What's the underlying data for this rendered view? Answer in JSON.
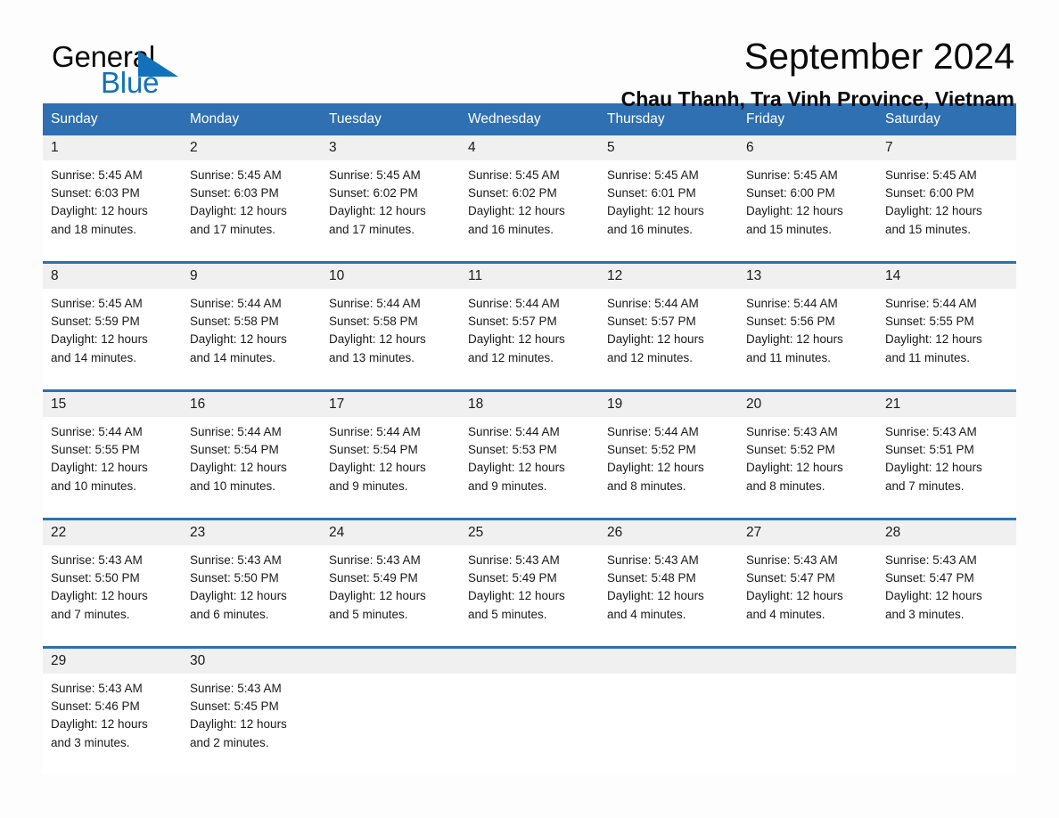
{
  "logo": {
    "word_one": "General",
    "word_two": "Blue",
    "triangle_icon": "triangle-icon",
    "accent_color": "#1271ba"
  },
  "header": {
    "title": "September 2024",
    "subtitle": "Chau Thanh, Tra Vinh Province, Vietnam"
  },
  "theme": {
    "header_blue": "#2e70b1",
    "daynum_band": "#f0f0f0",
    "page_background": "#fdfdfd",
    "text_color": "#1a1a1a"
  },
  "weekday_headers": [
    "Sunday",
    "Monday",
    "Tuesday",
    "Wednesday",
    "Thursday",
    "Friday",
    "Saturday"
  ],
  "weeks": [
    {
      "days": [
        {
          "number": "1",
          "sunrise": "Sunrise: 5:45 AM",
          "sunset": "Sunset: 6:03 PM",
          "daylight_line1": "Daylight: 12 hours",
          "daylight_line2": "and 18 minutes."
        },
        {
          "number": "2",
          "sunrise": "Sunrise: 5:45 AM",
          "sunset": "Sunset: 6:03 PM",
          "daylight_line1": "Daylight: 12 hours",
          "daylight_line2": "and 17 minutes."
        },
        {
          "number": "3",
          "sunrise": "Sunrise: 5:45 AM",
          "sunset": "Sunset: 6:02 PM",
          "daylight_line1": "Daylight: 12 hours",
          "daylight_line2": "and 17 minutes."
        },
        {
          "number": "4",
          "sunrise": "Sunrise: 5:45 AM",
          "sunset": "Sunset: 6:02 PM",
          "daylight_line1": "Daylight: 12 hours",
          "daylight_line2": "and 16 minutes."
        },
        {
          "number": "5",
          "sunrise": "Sunrise: 5:45 AM",
          "sunset": "Sunset: 6:01 PM",
          "daylight_line1": "Daylight: 12 hours",
          "daylight_line2": "and 16 minutes."
        },
        {
          "number": "6",
          "sunrise": "Sunrise: 5:45 AM",
          "sunset": "Sunset: 6:00 PM",
          "daylight_line1": "Daylight: 12 hours",
          "daylight_line2": "and 15 minutes."
        },
        {
          "number": "7",
          "sunrise": "Sunrise: 5:45 AM",
          "sunset": "Sunset: 6:00 PM",
          "daylight_line1": "Daylight: 12 hours",
          "daylight_line2": "and 15 minutes."
        }
      ]
    },
    {
      "days": [
        {
          "number": "8",
          "sunrise": "Sunrise: 5:45 AM",
          "sunset": "Sunset: 5:59 PM",
          "daylight_line1": "Daylight: 12 hours",
          "daylight_line2": "and 14 minutes."
        },
        {
          "number": "9",
          "sunrise": "Sunrise: 5:44 AM",
          "sunset": "Sunset: 5:58 PM",
          "daylight_line1": "Daylight: 12 hours",
          "daylight_line2": "and 14 minutes."
        },
        {
          "number": "10",
          "sunrise": "Sunrise: 5:44 AM",
          "sunset": "Sunset: 5:58 PM",
          "daylight_line1": "Daylight: 12 hours",
          "daylight_line2": "and 13 minutes."
        },
        {
          "number": "11",
          "sunrise": "Sunrise: 5:44 AM",
          "sunset": "Sunset: 5:57 PM",
          "daylight_line1": "Daylight: 12 hours",
          "daylight_line2": "and 12 minutes."
        },
        {
          "number": "12",
          "sunrise": "Sunrise: 5:44 AM",
          "sunset": "Sunset: 5:57 PM",
          "daylight_line1": "Daylight: 12 hours",
          "daylight_line2": "and 12 minutes."
        },
        {
          "number": "13",
          "sunrise": "Sunrise: 5:44 AM",
          "sunset": "Sunset: 5:56 PM",
          "daylight_line1": "Daylight: 12 hours",
          "daylight_line2": "and 11 minutes."
        },
        {
          "number": "14",
          "sunrise": "Sunrise: 5:44 AM",
          "sunset": "Sunset: 5:55 PM",
          "daylight_line1": "Daylight: 12 hours",
          "daylight_line2": "and 11 minutes."
        }
      ]
    },
    {
      "days": [
        {
          "number": "15",
          "sunrise": "Sunrise: 5:44 AM",
          "sunset": "Sunset: 5:55 PM",
          "daylight_line1": "Daylight: 12 hours",
          "daylight_line2": "and 10 minutes."
        },
        {
          "number": "16",
          "sunrise": "Sunrise: 5:44 AM",
          "sunset": "Sunset: 5:54 PM",
          "daylight_line1": "Daylight: 12 hours",
          "daylight_line2": "and 10 minutes."
        },
        {
          "number": "17",
          "sunrise": "Sunrise: 5:44 AM",
          "sunset": "Sunset: 5:54 PM",
          "daylight_line1": "Daylight: 12 hours",
          "daylight_line2": "and 9 minutes."
        },
        {
          "number": "18",
          "sunrise": "Sunrise: 5:44 AM",
          "sunset": "Sunset: 5:53 PM",
          "daylight_line1": "Daylight: 12 hours",
          "daylight_line2": "and 9 minutes."
        },
        {
          "number": "19",
          "sunrise": "Sunrise: 5:44 AM",
          "sunset": "Sunset: 5:52 PM",
          "daylight_line1": "Daylight: 12 hours",
          "daylight_line2": "and 8 minutes."
        },
        {
          "number": "20",
          "sunrise": "Sunrise: 5:43 AM",
          "sunset": "Sunset: 5:52 PM",
          "daylight_line1": "Daylight: 12 hours",
          "daylight_line2": "and 8 minutes."
        },
        {
          "number": "21",
          "sunrise": "Sunrise: 5:43 AM",
          "sunset": "Sunset: 5:51 PM",
          "daylight_line1": "Daylight: 12 hours",
          "daylight_line2": "and 7 minutes."
        }
      ]
    },
    {
      "days": [
        {
          "number": "22",
          "sunrise": "Sunrise: 5:43 AM",
          "sunset": "Sunset: 5:50 PM",
          "daylight_line1": "Daylight: 12 hours",
          "daylight_line2": "and 7 minutes."
        },
        {
          "number": "23",
          "sunrise": "Sunrise: 5:43 AM",
          "sunset": "Sunset: 5:50 PM",
          "daylight_line1": "Daylight: 12 hours",
          "daylight_line2": "and 6 minutes."
        },
        {
          "number": "24",
          "sunrise": "Sunrise: 5:43 AM",
          "sunset": "Sunset: 5:49 PM",
          "daylight_line1": "Daylight: 12 hours",
          "daylight_line2": "and 5 minutes."
        },
        {
          "number": "25",
          "sunrise": "Sunrise: 5:43 AM",
          "sunset": "Sunset: 5:49 PM",
          "daylight_line1": "Daylight: 12 hours",
          "daylight_line2": "and 5 minutes."
        },
        {
          "number": "26",
          "sunrise": "Sunrise: 5:43 AM",
          "sunset": "Sunset: 5:48 PM",
          "daylight_line1": "Daylight: 12 hours",
          "daylight_line2": "and 4 minutes."
        },
        {
          "number": "27",
          "sunrise": "Sunrise: 5:43 AM",
          "sunset": "Sunset: 5:47 PM",
          "daylight_line1": "Daylight: 12 hours",
          "daylight_line2": "and 4 minutes."
        },
        {
          "number": "28",
          "sunrise": "Sunrise: 5:43 AM",
          "sunset": "Sunset: 5:47 PM",
          "daylight_line1": "Daylight: 12 hours",
          "daylight_line2": "and 3 minutes."
        }
      ]
    },
    {
      "days": [
        {
          "number": "29",
          "sunrise": "Sunrise: 5:43 AM",
          "sunset": "Sunset: 5:46 PM",
          "daylight_line1": "Daylight: 12 hours",
          "daylight_line2": "and 3 minutes."
        },
        {
          "number": "30",
          "sunrise": "Sunrise: 5:43 AM",
          "sunset": "Sunset: 5:45 PM",
          "daylight_line1": "Daylight: 12 hours",
          "daylight_line2": "and 2 minutes."
        },
        {
          "number": "",
          "sunrise": "",
          "sunset": "",
          "daylight_line1": "",
          "daylight_line2": ""
        },
        {
          "number": "",
          "sunrise": "",
          "sunset": "",
          "daylight_line1": "",
          "daylight_line2": ""
        },
        {
          "number": "",
          "sunrise": "",
          "sunset": "",
          "daylight_line1": "",
          "daylight_line2": ""
        },
        {
          "number": "",
          "sunrise": "",
          "sunset": "",
          "daylight_line1": "",
          "daylight_line2": ""
        },
        {
          "number": "",
          "sunrise": "",
          "sunset": "",
          "daylight_line1": "",
          "daylight_line2": ""
        }
      ]
    }
  ]
}
